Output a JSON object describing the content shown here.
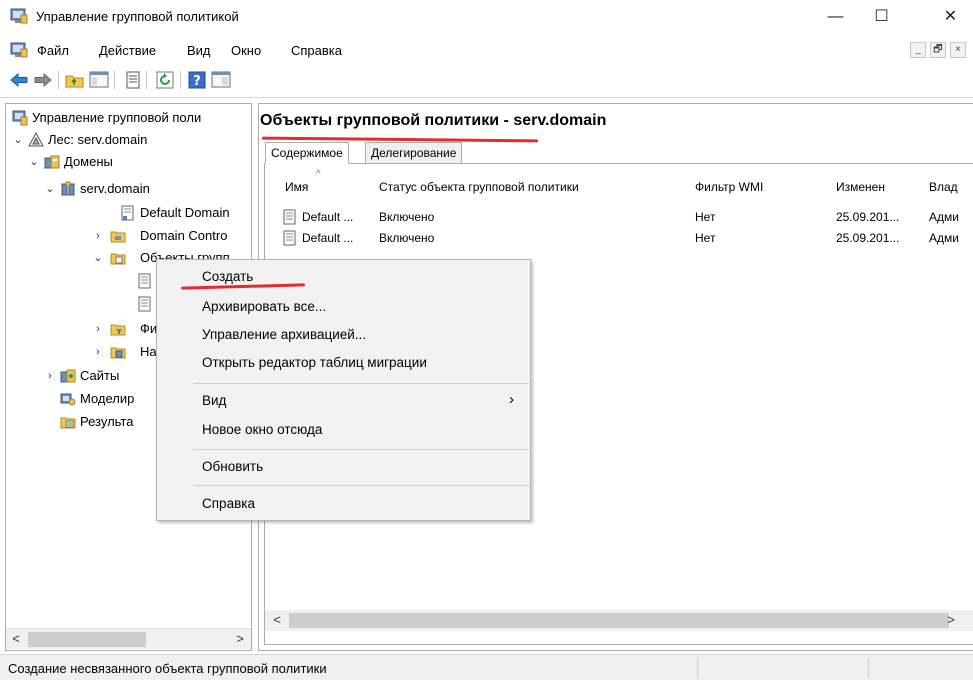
{
  "window": {
    "title": "Управление групповой политикой",
    "controls": {
      "minimize": "—",
      "maximize": "☐",
      "close": "✕"
    }
  },
  "menubar": {
    "items": [
      "Файл",
      "Действие",
      "Вид",
      "Окно",
      "Справка"
    ],
    "mdi": {
      "minimize": "_",
      "restore": "🗗",
      "close": "×"
    }
  },
  "toolbar": {
    "icons": [
      "back-arrow-icon",
      "forward-arrow-icon",
      "folder-up-icon",
      "show-hide-tree-icon",
      "properties-icon",
      "refresh-icon",
      "help-icon",
      "console-view-icon"
    ]
  },
  "tree": {
    "nodes": [
      {
        "label": "Управление групповой поли",
        "icon": "gpmc-icon",
        "twisty": ""
      },
      {
        "label": "Лес: serv.domain",
        "icon": "forest-icon",
        "twisty": "⌄"
      },
      {
        "label": "Домены",
        "icon": "domains-icon",
        "twisty": "⌄"
      },
      {
        "label": "serv.domain",
        "icon": "domain-icon",
        "twisty": "⌄"
      },
      {
        "label": "Default Domain",
        "icon": "gpo-link-icon",
        "twisty": ""
      },
      {
        "label": "Domain Contro",
        "icon": "ou-folder-icon",
        "twisty": "›"
      },
      {
        "label": "Объекты групп",
        "icon": "gpo-folder-icon",
        "twisty": "⌄"
      },
      {
        "label": "",
        "icon": "gpo-icon",
        "twisty": ""
      },
      {
        "label": "",
        "icon": "gpo-icon",
        "twisty": ""
      },
      {
        "label": "Фи",
        "icon": "wmi-folder-icon",
        "twisty": "›"
      },
      {
        "label": "На",
        "icon": "starter-folder-icon",
        "twisty": "›"
      },
      {
        "label": "Сайты",
        "icon": "sites-icon",
        "twisty": "›"
      },
      {
        "label": "Моделир",
        "icon": "modeling-icon",
        "twisty": ""
      },
      {
        "label": "Результа",
        "icon": "results-icon",
        "twisty": ""
      }
    ]
  },
  "scroll": {
    "left": "<",
    "right": ">"
  },
  "panel": {
    "title": "Объекты групповой политики - serv.domain",
    "tabs": [
      "Содержимое",
      "Делегирование"
    ],
    "columns": [
      "Имя",
      "Статус объекта групповой политики",
      "Фильтр WMI",
      "Изменен",
      "Влад"
    ],
    "sort_caret": "^",
    "rows": [
      {
        "name": "Default ...",
        "status": "Включено",
        "wmi": "Нет",
        "modified": "25.09.201...",
        "owner": "Адми"
      },
      {
        "name": "Default ...",
        "status": "Включено",
        "wmi": "Нет",
        "modified": "25.09.201...",
        "owner": "Адми"
      }
    ]
  },
  "context_menu": {
    "items": [
      "Создать",
      "Архивировать все...",
      "Управление архивацией...",
      "Открыть редактор таблиц миграции",
      "Вид",
      "Новое окно отсюда",
      "Обновить",
      "Справка"
    ],
    "submenu_arrow": "›"
  },
  "status": {
    "text": "Создание несвязанного объекта групповой политики"
  },
  "colors": {
    "annotation_red": "#e52b2b",
    "menu_background": "#f2f2f2",
    "border": "#adadad"
  }
}
